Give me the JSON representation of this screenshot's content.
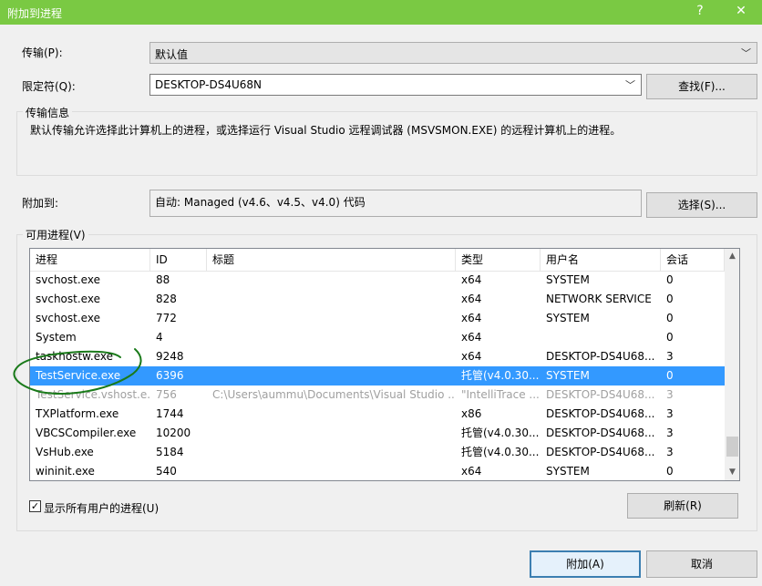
{
  "window": {
    "title": "附加到进程",
    "help_glyph": "?",
    "close_glyph": "✕"
  },
  "transport": {
    "label": "传输(P):",
    "value": "默认值"
  },
  "qualifier": {
    "label": "限定符(Q):",
    "value": "DESKTOP-DS4U68N",
    "find_button": "查找(F)..."
  },
  "transport_info": {
    "title": "传输信息",
    "text": "默认传输允许选择此计算机上的进程，或选择运行 Visual Studio 远程调试器 (MSVSMON.EXE) 的远程计算机上的进程。"
  },
  "attach_to": {
    "label": "附加到:",
    "value": "自动: Managed (v4.6、v4.5、v4.0) 代码",
    "select_button": "选择(S)..."
  },
  "processes": {
    "group_title": "可用进程(V)",
    "columns": [
      "进程",
      "ID",
      "标题",
      "类型",
      "用户名",
      "会话"
    ],
    "rows": [
      [
        "svchost.exe",
        "88",
        "",
        "x64",
        "SYSTEM",
        "0"
      ],
      [
        "svchost.exe",
        "828",
        "",
        "x64",
        "NETWORK SERVICE",
        "0"
      ],
      [
        "svchost.exe",
        "772",
        "",
        "x64",
        "SYSTEM",
        "0"
      ],
      [
        "System",
        "4",
        "",
        "x64",
        "",
        "0"
      ],
      [
        "taskhostw.exe",
        "9248",
        "",
        "x64",
        "DESKTOP-DS4U68...",
        "3"
      ],
      [
        "TestService.exe",
        "6396",
        "",
        "托管(v4.0.30...",
        "SYSTEM",
        "0"
      ],
      [
        "TestService.vshost.e...",
        "756",
        "C:\\Users\\aummu\\Documents\\Visual Studio ...",
        "\"IntelliTrace ...",
        "DESKTOP-DS4U68...",
        "3"
      ],
      [
        "TXPlatform.exe",
        "1744",
        "",
        "x86",
        "DESKTOP-DS4U68...",
        "3"
      ],
      [
        "VBCSCompiler.exe",
        "10200",
        "",
        "托管(v4.0.30...",
        "DESKTOP-DS4U68...",
        "3"
      ],
      [
        "VsHub.exe",
        "5184",
        "",
        "托管(v4.0.30...",
        "DESKTOP-DS4U68...",
        "3"
      ],
      [
        "wininit.exe",
        "540",
        "",
        "x64",
        "SYSTEM",
        "0"
      ]
    ],
    "selected_row": 5,
    "dimmed_row": 6,
    "show_all_users": {
      "label": "显示所有用户的进程(U)",
      "checked": true
    },
    "refresh_button": "刷新(R)"
  },
  "footer": {
    "attach_button": "附加(A)",
    "cancel_button": "取消"
  },
  "colors": {
    "titlebar": "#7ac943",
    "selection": "#3399ff",
    "annotation_ink": "#1a7a1a"
  }
}
